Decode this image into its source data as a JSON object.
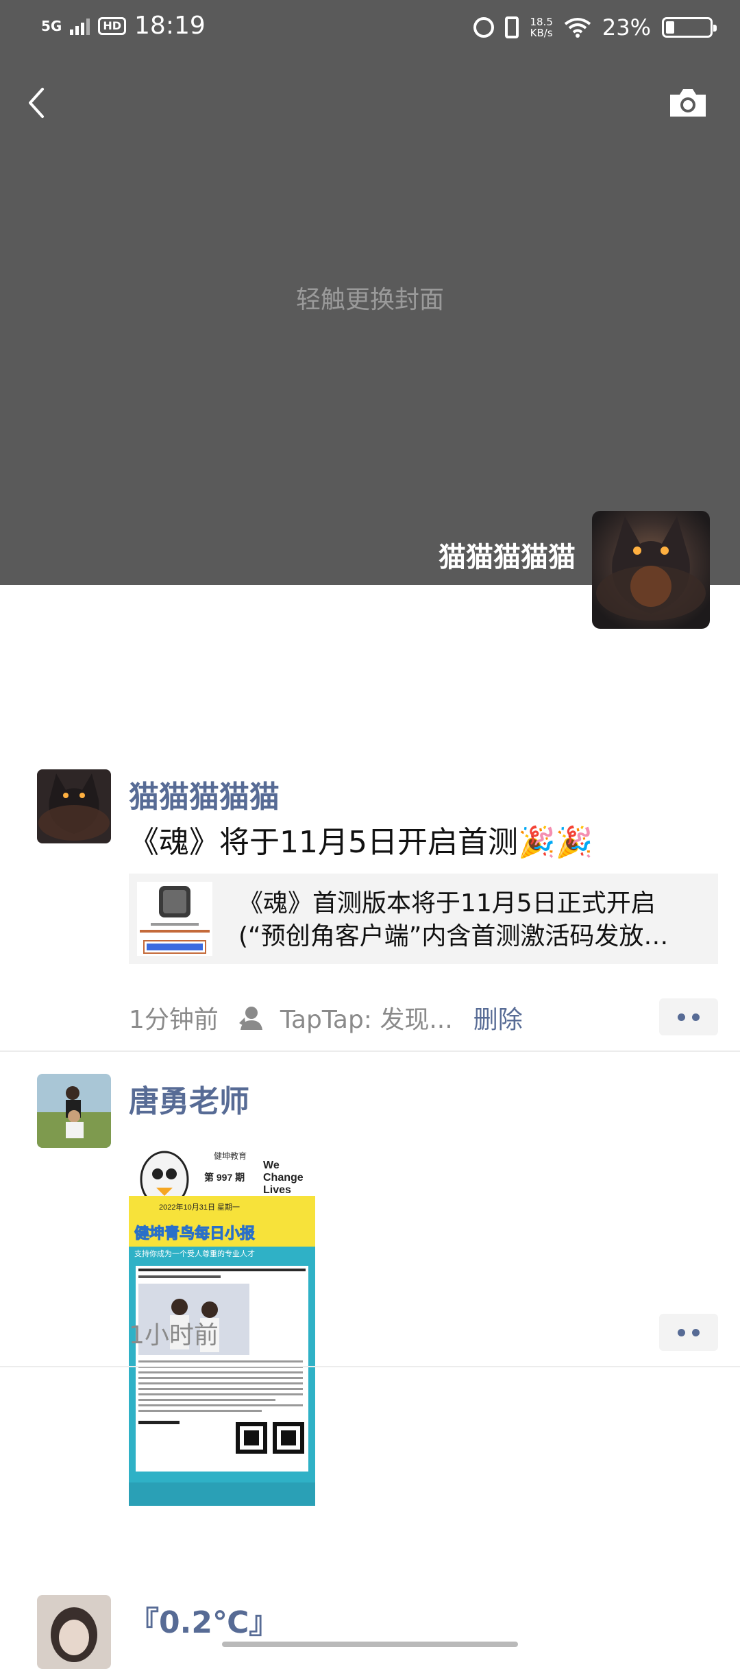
{
  "status_bar": {
    "network": "5G",
    "hd": "HD",
    "time": "18:19",
    "net_speed_value": "18.5",
    "net_speed_unit": "KB/s",
    "battery_percent": "23%",
    "battery_level": 0.23
  },
  "cover": {
    "hint": "轻触更换封面",
    "profile_name": "猫猫猫猫猫"
  },
  "posts": [
    {
      "name": "猫猫猫猫猫",
      "text": "《魂》将于11月5日开启首测🎉🎉",
      "link": {
        "line1": "《魂》首测版本将于11月5日正式开启",
        "line2": "(“预创角客户端”内含首测激活码发放…"
      },
      "time": "1分钟前",
      "source": "TapTap: 发现...",
      "delete_label": "删除"
    },
    {
      "name": "唐勇老师",
      "time": "1小时前",
      "image": {
        "brand": "We Change Lives",
        "issue": "第 997 期",
        "date": "2022年10月31日   星期一",
        "title": "健坤青鸟每日小报",
        "subtitle": "支持你成为一个受人尊重的专业人才"
      }
    },
    {
      "name": "『0.2℃』"
    }
  ],
  "colors": {
    "link_blue": "#576b95",
    "cover_gray": "#5a5a5a"
  }
}
